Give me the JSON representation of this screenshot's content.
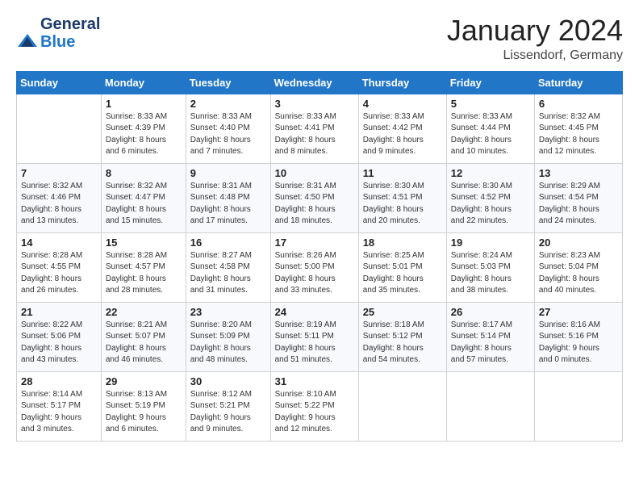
{
  "header": {
    "logo_general": "General",
    "logo_blue": "Blue",
    "month_year": "January 2024",
    "location": "Lissendorf, Germany"
  },
  "weekdays": [
    "Sunday",
    "Monday",
    "Tuesday",
    "Wednesday",
    "Thursday",
    "Friday",
    "Saturday"
  ],
  "weeks": [
    [
      {
        "day": "",
        "info": ""
      },
      {
        "day": "1",
        "info": "Sunrise: 8:33 AM\nSunset: 4:39 PM\nDaylight: 8 hours\nand 6 minutes."
      },
      {
        "day": "2",
        "info": "Sunrise: 8:33 AM\nSunset: 4:40 PM\nDaylight: 8 hours\nand 7 minutes."
      },
      {
        "day": "3",
        "info": "Sunrise: 8:33 AM\nSunset: 4:41 PM\nDaylight: 8 hours\nand 8 minutes."
      },
      {
        "day": "4",
        "info": "Sunrise: 8:33 AM\nSunset: 4:42 PM\nDaylight: 8 hours\nand 9 minutes."
      },
      {
        "day": "5",
        "info": "Sunrise: 8:33 AM\nSunset: 4:44 PM\nDaylight: 8 hours\nand 10 minutes."
      },
      {
        "day": "6",
        "info": "Sunrise: 8:32 AM\nSunset: 4:45 PM\nDaylight: 8 hours\nand 12 minutes."
      }
    ],
    [
      {
        "day": "7",
        "info": "Sunrise: 8:32 AM\nSunset: 4:46 PM\nDaylight: 8 hours\nand 13 minutes."
      },
      {
        "day": "8",
        "info": "Sunrise: 8:32 AM\nSunset: 4:47 PM\nDaylight: 8 hours\nand 15 minutes."
      },
      {
        "day": "9",
        "info": "Sunrise: 8:31 AM\nSunset: 4:48 PM\nDaylight: 8 hours\nand 17 minutes."
      },
      {
        "day": "10",
        "info": "Sunrise: 8:31 AM\nSunset: 4:50 PM\nDaylight: 8 hours\nand 18 minutes."
      },
      {
        "day": "11",
        "info": "Sunrise: 8:30 AM\nSunset: 4:51 PM\nDaylight: 8 hours\nand 20 minutes."
      },
      {
        "day": "12",
        "info": "Sunrise: 8:30 AM\nSunset: 4:52 PM\nDaylight: 8 hours\nand 22 minutes."
      },
      {
        "day": "13",
        "info": "Sunrise: 8:29 AM\nSunset: 4:54 PM\nDaylight: 8 hours\nand 24 minutes."
      }
    ],
    [
      {
        "day": "14",
        "info": "Sunrise: 8:28 AM\nSunset: 4:55 PM\nDaylight: 8 hours\nand 26 minutes."
      },
      {
        "day": "15",
        "info": "Sunrise: 8:28 AM\nSunset: 4:57 PM\nDaylight: 8 hours\nand 28 minutes."
      },
      {
        "day": "16",
        "info": "Sunrise: 8:27 AM\nSunset: 4:58 PM\nDaylight: 8 hours\nand 31 minutes."
      },
      {
        "day": "17",
        "info": "Sunrise: 8:26 AM\nSunset: 5:00 PM\nDaylight: 8 hours\nand 33 minutes."
      },
      {
        "day": "18",
        "info": "Sunrise: 8:25 AM\nSunset: 5:01 PM\nDaylight: 8 hours\nand 35 minutes."
      },
      {
        "day": "19",
        "info": "Sunrise: 8:24 AM\nSunset: 5:03 PM\nDaylight: 8 hours\nand 38 minutes."
      },
      {
        "day": "20",
        "info": "Sunrise: 8:23 AM\nSunset: 5:04 PM\nDaylight: 8 hours\nand 40 minutes."
      }
    ],
    [
      {
        "day": "21",
        "info": "Sunrise: 8:22 AM\nSunset: 5:06 PM\nDaylight: 8 hours\nand 43 minutes."
      },
      {
        "day": "22",
        "info": "Sunrise: 8:21 AM\nSunset: 5:07 PM\nDaylight: 8 hours\nand 46 minutes."
      },
      {
        "day": "23",
        "info": "Sunrise: 8:20 AM\nSunset: 5:09 PM\nDaylight: 8 hours\nand 48 minutes."
      },
      {
        "day": "24",
        "info": "Sunrise: 8:19 AM\nSunset: 5:11 PM\nDaylight: 8 hours\nand 51 minutes."
      },
      {
        "day": "25",
        "info": "Sunrise: 8:18 AM\nSunset: 5:12 PM\nDaylight: 8 hours\nand 54 minutes."
      },
      {
        "day": "26",
        "info": "Sunrise: 8:17 AM\nSunset: 5:14 PM\nDaylight: 8 hours\nand 57 minutes."
      },
      {
        "day": "27",
        "info": "Sunrise: 8:16 AM\nSunset: 5:16 PM\nDaylight: 9 hours\nand 0 minutes."
      }
    ],
    [
      {
        "day": "28",
        "info": "Sunrise: 8:14 AM\nSunset: 5:17 PM\nDaylight: 9 hours\nand 3 minutes."
      },
      {
        "day": "29",
        "info": "Sunrise: 8:13 AM\nSunset: 5:19 PM\nDaylight: 9 hours\nand 6 minutes."
      },
      {
        "day": "30",
        "info": "Sunrise: 8:12 AM\nSunset: 5:21 PM\nDaylight: 9 hours\nand 9 minutes."
      },
      {
        "day": "31",
        "info": "Sunrise: 8:10 AM\nSunset: 5:22 PM\nDaylight: 9 hours\nand 12 minutes."
      },
      {
        "day": "",
        "info": ""
      },
      {
        "day": "",
        "info": ""
      },
      {
        "day": "",
        "info": ""
      }
    ]
  ]
}
